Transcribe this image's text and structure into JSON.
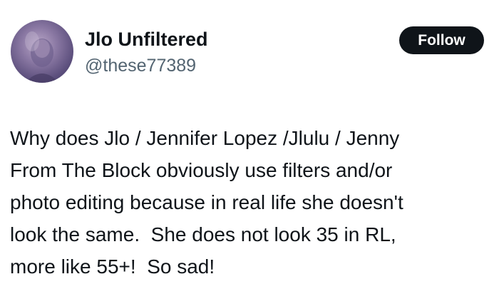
{
  "author": {
    "display_name": "Jlo Unfiltered",
    "handle": "@these77389",
    "avatar_icon": "profile-photo"
  },
  "actions": {
    "follow_label": "Follow"
  },
  "tweet": {
    "lines": [
      "Why does Jlo / Jennifer Lopez /Jlulu / Jenny",
      "From The Block obviously use filters and/or",
      "photo editing because in real life she doesn't",
      "look the same.  She does not look 35 in RL,",
      "more like 55+!  So sad!"
    ]
  },
  "colors": {
    "text": "#0f1419",
    "secondary_text": "#536471",
    "button_bg": "#0f1419",
    "button_text": "#ffffff",
    "background": "#ffffff"
  }
}
